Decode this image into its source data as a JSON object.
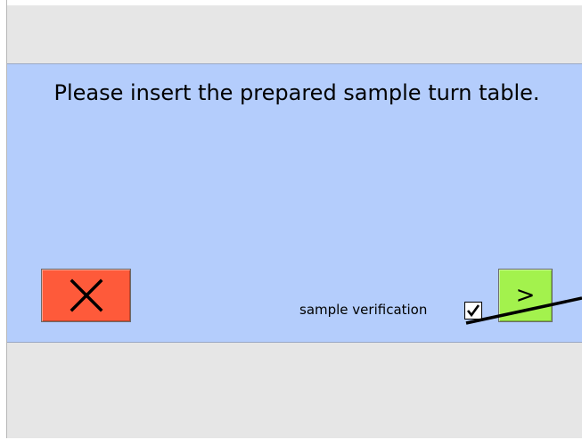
{
  "dialog": {
    "message": "Please insert the prepared sample turn table.",
    "cancel_icon": "x-mark-icon",
    "next_label": ">",
    "verification_label": "sample verification",
    "verification_checked": true
  },
  "colors": {
    "panel_background": "#b4cdfc",
    "cancel_button": "#fe5a3a",
    "next_button": "#a3f24d",
    "window_background": "#e6e6e6"
  }
}
